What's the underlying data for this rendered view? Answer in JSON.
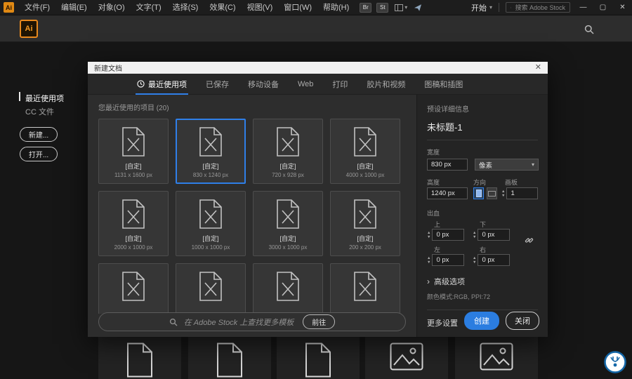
{
  "window": {
    "minimize": "—",
    "maximize": "▢",
    "close": "✕"
  },
  "menubar": {
    "app_badge": "Ai",
    "menus": [
      "文件(F)",
      "编辑(E)",
      "对象(O)",
      "文字(T)",
      "选择(S)",
      "效果(C)",
      "视图(V)",
      "窗口(W)",
      "帮助(H)"
    ],
    "bridge_badge": "Br",
    "stock_badge": "St",
    "start_button": "开始",
    "search_placeholder": "搜索 Adobe Stock"
  },
  "appbar": {
    "app_icon": "Ai"
  },
  "home": {
    "nav_recent": "最近使用项",
    "nav_cc_files": "CC 文件",
    "new_button": "新建...",
    "open_button": "打开..."
  },
  "dialog": {
    "title": "新建文档",
    "tabs": [
      "最近使用项",
      "已保存",
      "移动设备",
      "Web",
      "打印",
      "胶片和视频",
      "图稿和插图"
    ],
    "recent_heading": "您最近使用的项目 (20)",
    "templates": [
      {
        "name": "[自定]",
        "size": "1131 x 1600 px"
      },
      {
        "name": "[自定]",
        "size": "830 x 1240 px"
      },
      {
        "name": "[自定]",
        "size": "720 x 928 px"
      },
      {
        "name": "[自定]",
        "size": "4000 x 1000 px"
      },
      {
        "name": "[自定]",
        "size": "2000 x 1000 px"
      },
      {
        "name": "[自定]",
        "size": "1000 x 1000 px"
      },
      {
        "name": "[自定]",
        "size": "3000 x 1000 px"
      },
      {
        "name": "[自定]",
        "size": "200 x 200 px"
      }
    ],
    "stock_search_placeholder": "在 Adobe Stock 上查找更多模板",
    "go_button": "前往"
  },
  "preset": {
    "heading": "预设详细信息",
    "doc_name": "未标题-1",
    "width_label": "宽度",
    "width_value": "830 px",
    "unit_value": "像素",
    "height_label": "高度",
    "height_value": "1240 px",
    "orientation_label": "方向",
    "artboard_label": "画板",
    "artboard_value": "1",
    "bleed_label": "出血",
    "bleed_top_label": "上",
    "bleed_top_value": "0 px",
    "bleed_bottom_label": "下",
    "bleed_bottom_value": "0 px",
    "bleed_left_label": "左",
    "bleed_left_value": "0 px",
    "bleed_right_label": "右",
    "bleed_right_value": "0 px",
    "advanced_label": "高级选项",
    "color_info": "颜色模式:RGB, PPI:72",
    "more_settings": "更多设置",
    "create_button": "创建",
    "close_button": "关闭"
  },
  "colors": {
    "accent_blue": "#2f7fe8",
    "brand_orange": "#f59a23"
  }
}
